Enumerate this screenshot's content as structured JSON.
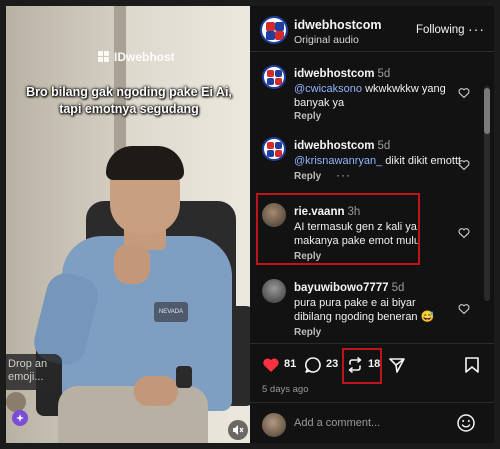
{
  "video": {
    "brand": "IDwebhost",
    "caption_line1": "Bro bilang gak ngoding pake Ei Ai,",
    "caption_line2": "tapi emotnya segudang",
    "shirt_badge": "NEVADA",
    "drop_emoji_label": "Drop an emoji...",
    "icons": [
      "sparkle-icon",
      "mute-icon"
    ]
  },
  "header": {
    "handle": "idwebhostcom",
    "subtitle": "Original audio",
    "follow_label": "Following",
    "more_label": "···"
  },
  "comments": [
    {
      "handle": "idwebhostcom",
      "time": "5d",
      "mention": "@cwicaksono",
      "text": " wkwkwkkw yang banyak ya",
      "reply": "Reply",
      "avatar": "logo"
    },
    {
      "handle": "idwebhostcom",
      "time": "5d",
      "mention": "@krisnawanryan_",
      "text": " dikit dikit emottt",
      "reply": "Reply",
      "more": "···",
      "avatar": "logo"
    },
    {
      "handle": "rie.vaann",
      "time": "3h",
      "mention": "",
      "text": "AI termasuk gen z kali ya, makanya pake emot mulu",
      "reply": "Reply",
      "avatar": "photo"
    },
    {
      "handle": "bayuwibowo7777",
      "time": "5d",
      "mention": "",
      "text": "pura pura pake e ai biyar dibilang ngoding beneran 😅",
      "reply": "Reply",
      "avatar": "photo"
    }
  ],
  "actions": {
    "likes": "81",
    "comments": "23",
    "reposts": "18",
    "date": "5 days ago",
    "icons": [
      "heart-icon",
      "comment-icon",
      "repost-icon",
      "share-icon",
      "bookmark-icon"
    ]
  },
  "add_comment": {
    "placeholder": "Add a comment..."
  },
  "colors": {
    "background": "#121212",
    "like": "#ff3040",
    "mention": "#8fb4ff",
    "highlight": "#c0141b",
    "brand_blue": "#1f3fa0",
    "brand_red": "#d42a2a"
  }
}
